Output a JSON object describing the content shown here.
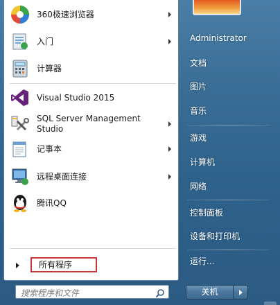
{
  "programs": [
    {
      "label": "360极速浏览器",
      "icon": "360-browser-icon",
      "submenu": true
    },
    {
      "label": "入门",
      "icon": "getting-started-icon",
      "submenu": true
    },
    {
      "label": "计算器",
      "icon": "calculator-icon",
      "submenu": false
    },
    {
      "label": "Visual Studio 2015",
      "icon": "visual-studio-icon",
      "submenu": false
    },
    {
      "label": "SQL Server Management Studio",
      "icon": "sql-server-icon",
      "submenu": true
    },
    {
      "label": "记事本",
      "icon": "notepad-icon",
      "submenu": true
    },
    {
      "label": "远程桌面连接",
      "icon": "remote-desktop-icon",
      "submenu": true
    },
    {
      "label": "腾讯QQ",
      "icon": "qq-icon",
      "submenu": false
    }
  ],
  "all_programs_label": "所有程序",
  "search": {
    "placeholder": "搜索程序和文件"
  },
  "right_links": [
    "Administrator",
    "文档",
    "图片",
    "音乐",
    "游戏",
    "计算机",
    "网络",
    "控制面板",
    "设备和打印机",
    "运行..."
  ],
  "shutdown_label": "关机",
  "colors": {
    "highlight_border": "#c8373a",
    "panel_bg": "#2f628b"
  }
}
